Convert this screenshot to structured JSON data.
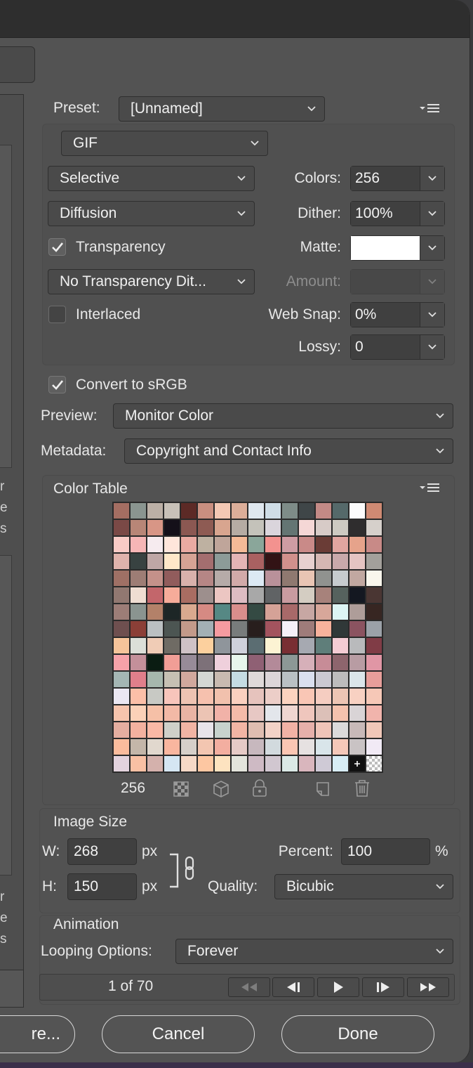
{
  "dialog": {
    "preset_label": "Preset:",
    "preset_value": "[Unnamed]",
    "format_value": "GIF",
    "reduction_value": "Selective",
    "dither_algo_value": "Diffusion",
    "transparency_label": "Transparency",
    "transparency_checked": true,
    "transparency_dither_value": "No Transparency Dit...",
    "interlaced_label": "Interlaced",
    "interlaced_checked": false,
    "colors_label": "Colors:",
    "colors_value": "256",
    "dither_label": "Dither:",
    "dither_value": "100%",
    "matte_label": "Matte:",
    "matte_color": "#ffffff",
    "amount_label": "Amount:",
    "web_snap_label": "Web Snap:",
    "web_snap_value": "0%",
    "lossy_label": "Lossy:",
    "lossy_value": "0",
    "convert_label": "Convert to sRGB",
    "convert_checked": true,
    "preview_label": "Preview:",
    "preview_value": "Monitor Color",
    "metadata_label": "Metadata:",
    "metadata_value": "Copyright and Contact Info"
  },
  "color_table": {
    "title": "Color Table",
    "count": "256",
    "colors": [
      "#a46e62",
      "#8a9590",
      "#bcb0a6",
      "#c8c1b8",
      "#5c2a26",
      "#c98f80",
      "#f3c8b4",
      "#dcae99",
      "#dfe7ee",
      "#cfdde6",
      "#7e8c88",
      "#3f4648",
      "#c38a86",
      "#55696a",
      "#fbfbfb",
      "#cf8a73",
      "#7a4946",
      "#b88677",
      "#d89686",
      "#141019",
      "#8b5852",
      "#8e5b53",
      "#d8a58f",
      "#b6aca3",
      "#c4c2ba",
      "#dad5dc",
      "#647573",
      "#f5d7d6",
      "#d7cbc7",
      "#cdcac2",
      "#2f2d2e",
      "#d6d0cb",
      "#f9cbc6",
      "#f6b6b6",
      "#f6ebef",
      "#ffe6db",
      "#e9aaa2",
      "#beb1a1",
      "#bfa59a",
      "#f4ba97",
      "#8aa69a",
      "#f3928f",
      "#ce9ca3",
      "#c98a88",
      "#6a3c36",
      "#e0a5a0",
      "#e6a38b",
      "#c88a87",
      "#dfb3ac",
      "#384241",
      "#bfa7a6",
      "#ffe8c9",
      "#d6a395",
      "#a46e6f",
      "#8c9b98",
      "#e3b4b5",
      "#a96161",
      "#321315",
      "#d1908c",
      "#e7d0cf",
      "#d5b7b3",
      "#c9a9ab",
      "#e5c4c2",
      "#a3a09b",
      "#9f7065",
      "#9d7d75",
      "#c4918a",
      "#915c5c",
      "#d8b1ab",
      "#b68685",
      "#b6aba8",
      "#d2aaa9",
      "#dce9f4",
      "#b9919a",
      "#8f7970",
      "#e9c5b4",
      "#90928f",
      "#c7cbce",
      "#c1a8a1",
      "#f9f6ec",
      "#917871",
      "#efddd2",
      "#c3666b",
      "#f6ac9a",
      "#a96d62",
      "#9d8f8d",
      "#ecc6c2",
      "#ddbcc2",
      "#a8a8a8",
      "#606365",
      "#c99ba0",
      "#d4cdc2",
      "#a7827b",
      "#56625e",
      "#141821",
      "#4a3633",
      "#9c7d77",
      "#8a9490",
      "#b38169",
      "#1d2626",
      "#d9a98f",
      "#d68a83",
      "#568884",
      "#d98e8c",
      "#344a43",
      "#d5a297",
      "#a86969",
      "#c7a7a3",
      "#d7a79a",
      "#ddf5f4",
      "#ae9d99",
      "#372622",
      "#6e4f4f",
      "#8b3f37",
      "#bbc0c2",
      "#4c5552",
      "#c39a8a",
      "#a3b0b5",
      "#f59ba0",
      "#787c7c",
      "#281e1d",
      "#a3535e",
      "#f5f0f8",
      "#9f7c7a",
      "#f8b29c",
      "#303838",
      "#8b5360",
      "#9ba1a8",
      "#f6c49a",
      "#dcdfd8",
      "#f0ccb6",
      "#6f6b64",
      "#cfc2c6",
      "#fcd09e",
      "#8f959b",
      "#cfd1db",
      "#5b6d72",
      "#fcf3d3",
      "#792e33",
      "#a6a9b1",
      "#5f7e7a",
      "#f4ccd4",
      "#b9babc",
      "#803c46",
      "#f6a2a9",
      "#c4909a",
      "#0a1c12",
      "#f19e96",
      "#978b98",
      "#7d7179",
      "#efd0dc",
      "#e7f6ec",
      "#8f6074",
      "#b38a99",
      "#8c9896",
      "#d6b0b9",
      "#c78c97",
      "#8d656d",
      "#b89ca3",
      "#e096a5",
      "#a4b6b4",
      "#e07f8b",
      "#a6b7ad",
      "#c6c0b3",
      "#d1a89d",
      "#d4d7d3",
      "#c8bab0",
      "#c5dce3",
      "#dfd9d9",
      "#dcd5d8",
      "#b9c0c3",
      "#dadfee",
      "#cbc9d2",
      "#bdbcbc",
      "#dbe6ea",
      "#e79e9a",
      "#ebe7f2",
      "#fbbfa8",
      "#c8c9c4",
      "#f7c5bb",
      "#eec3b2",
      "#f6c1ae",
      "#f1c1ad",
      "#fad0bf",
      "#e6c3bd",
      "#eccec8",
      "#fcd3bf",
      "#f9c6b5",
      "#f5cdc1",
      "#edc5b4",
      "#f8d1c2",
      "#f6c8b7",
      "#f6c4ad",
      "#fbd1b8",
      "#f6c0a7",
      "#f2b9a6",
      "#e9b4a4",
      "#ecc4b4",
      "#f1b2a8",
      "#f4bba9",
      "#e7c8c4",
      "#e3e6eb",
      "#efd6d0",
      "#efc6bd",
      "#dcc0b8",
      "#f4c2ae",
      "#d9d4d6",
      "#f1b4ac",
      "#e5aea0",
      "#f3b19f",
      "#fab8a5",
      "#cfd0c9",
      "#f1b4a4",
      "#e8e4ea",
      "#c7d2cd",
      "#f2b5a4",
      "#dfbdb0",
      "#f3d2c6",
      "#f1b2a5",
      "#e6b0aa",
      "#efc4b8",
      "#dcdada",
      "#c8b9b8",
      "#f0c7b8",
      "#fbbc9d",
      "#c4b6a9",
      "#e1d8ce",
      "#f9b69f",
      "#d6cfc9",
      "#f3c6b1",
      "#f3aea0",
      "#e6cac6",
      "#c7b8be",
      "#d2dade",
      "#fbc6b3",
      "#e6e1e1",
      "#d9e5ea",
      "#f5c8b9",
      "#c9c3c4",
      "#f1eaf5",
      "#e3d3de",
      "#f9c0a4",
      "#d4b1ac",
      "#d5e6f3",
      "#f6d8c6",
      "#fdc7a2",
      "#fde3c0",
      "#e3e4dc",
      "#cebac4",
      "#d1c7d0",
      "#dbe9e6",
      "#d9b6bd",
      "#cfcad6",
      "#d8edf5",
      "#111111",
      "checker"
    ]
  },
  "image_size": {
    "title": "Image Size",
    "w_label": "W:",
    "w_value": "268",
    "h_label": "H:",
    "h_value": "150",
    "unit": "px",
    "percent_label": "Percent:",
    "percent_value": "100",
    "percent_unit": "%",
    "quality_label": "Quality:",
    "quality_value": "Bicubic"
  },
  "animation": {
    "title": "Animation",
    "looping_label": "Looping Options:",
    "looping_value": "Forever",
    "frame_status": "1 of 70"
  },
  "buttons": {
    "save_label": "re...",
    "cancel_label": "Cancel",
    "done_label": "Done"
  },
  "sidebar_fragments": {
    "top": [
      "r",
      "e",
      "s"
    ],
    "bottom": [
      "r",
      "e",
      "s"
    ]
  }
}
